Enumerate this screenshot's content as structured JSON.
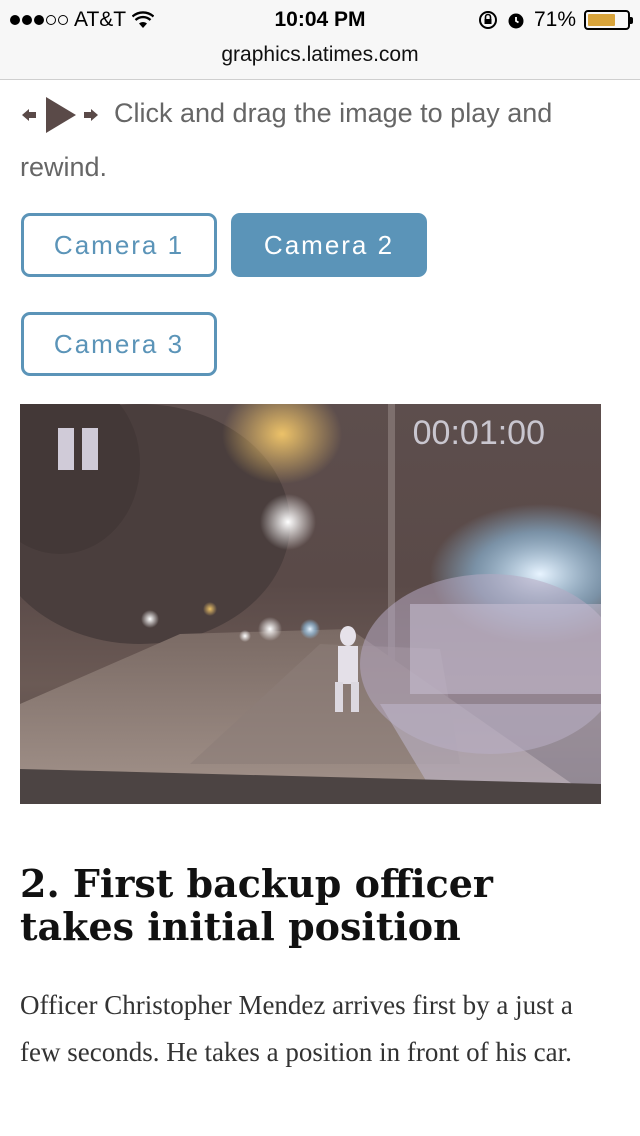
{
  "status_bar": {
    "carrier": "AT&T",
    "time": "10:04 PM",
    "battery_percent": "71%",
    "battery_level": 0.71,
    "signal_bars_filled": 3,
    "signal_bars_total": 5
  },
  "browser": {
    "url": "graphics.latimes.com"
  },
  "instruction": {
    "text": "Click and drag the image to play and rewind."
  },
  "camera_buttons": [
    {
      "label": "Camera 1",
      "active": false
    },
    {
      "label": "Camera 2",
      "active": true
    },
    {
      "label": "Camera 3",
      "active": false
    }
  ],
  "video": {
    "timecode": "00:01:00",
    "state": "playing"
  },
  "section": {
    "heading": "2. First backup officer takes initial position",
    "body": "Officer Christopher Mendez arrives first by a just a few seconds. He takes a position in front of his car."
  },
  "colors": {
    "accent": "#5b94b8",
    "battery": "#d7a33a"
  }
}
